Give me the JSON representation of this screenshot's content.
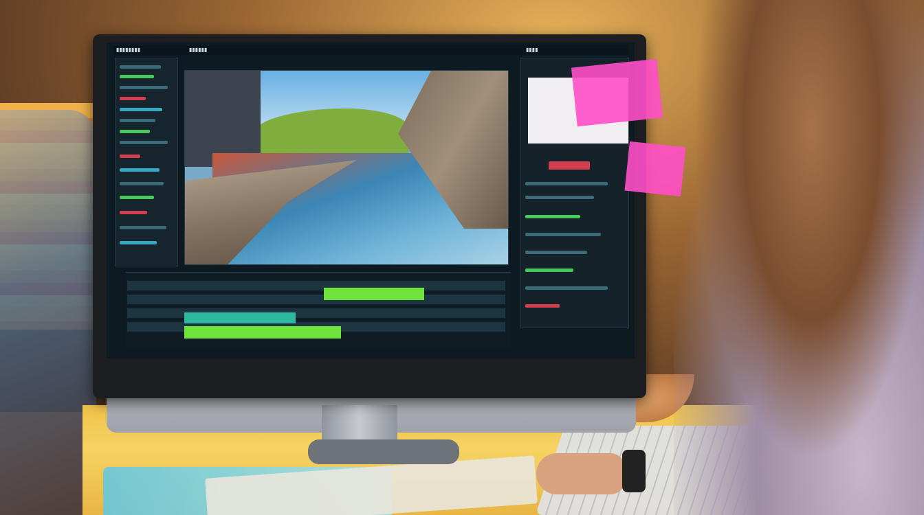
{
  "scene": {
    "description_visible": false
  },
  "screen": {
    "menu": [
      "▮▮▮▮▮▮▮▮",
      "▮▮▮▮▮▮",
      "▮▮▮▮"
    ]
  },
  "colors": {
    "accent_green": "#6fe23c",
    "accent_pink": "#ff4fc8",
    "panel_bg": "#15222a"
  }
}
